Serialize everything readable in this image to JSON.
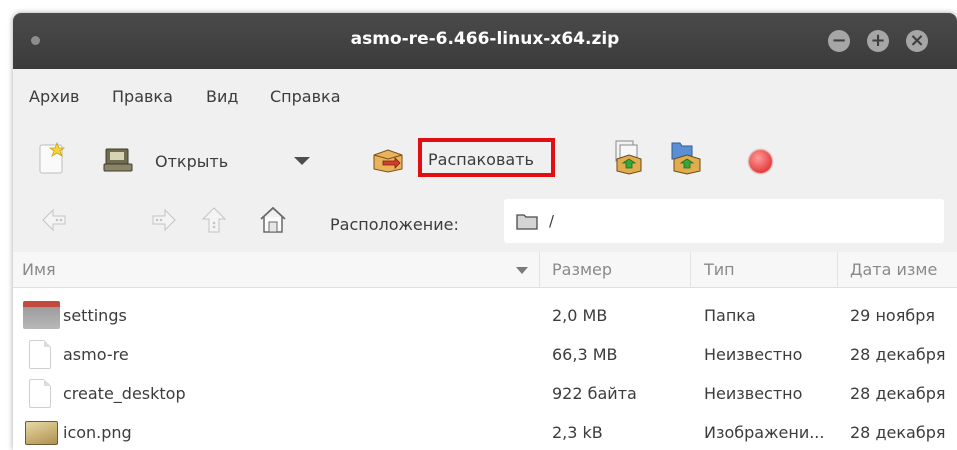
{
  "window": {
    "title": "asmo-re-6.466-linux-x64.zip",
    "controls": {
      "minimize": "−",
      "maximize": "+",
      "close": "×"
    }
  },
  "menu": [
    "Архив",
    "Правка",
    "Вид",
    "Справка"
  ],
  "toolbar": {
    "open_label": "Открыть",
    "extract_label": "Распаковать",
    "highlight_color": "#e30d14",
    "icons": [
      "new-archive-icon",
      "open-archive-icon",
      "dropdown-arrow-icon",
      "extract-icon",
      "add-files-icon",
      "add-folder-icon",
      "stop-icon"
    ]
  },
  "navigation": {
    "location_label": "Расположение:",
    "path": "/"
  },
  "columns": [
    "Имя",
    "Размер",
    "Тип",
    "Дата изме"
  ],
  "files": [
    {
      "name": "settings",
      "size": "2,0 MB",
      "type": "Папка",
      "date": "29 ноября",
      "icon": "folder-icon"
    },
    {
      "name": "asmo-re",
      "size": "66,3 MB",
      "type": "Неизвестно",
      "date": "28 декабря",
      "icon": "document-icon"
    },
    {
      "name": "create_desktop",
      "size": "922 байта",
      "type": "Неизвестно",
      "date": "28 декабря",
      "icon": "document-icon"
    },
    {
      "name": "icon.png",
      "size": "2,3 kB",
      "type": "Изображени...",
      "date": "28 декабря",
      "icon": "image-icon"
    }
  ]
}
